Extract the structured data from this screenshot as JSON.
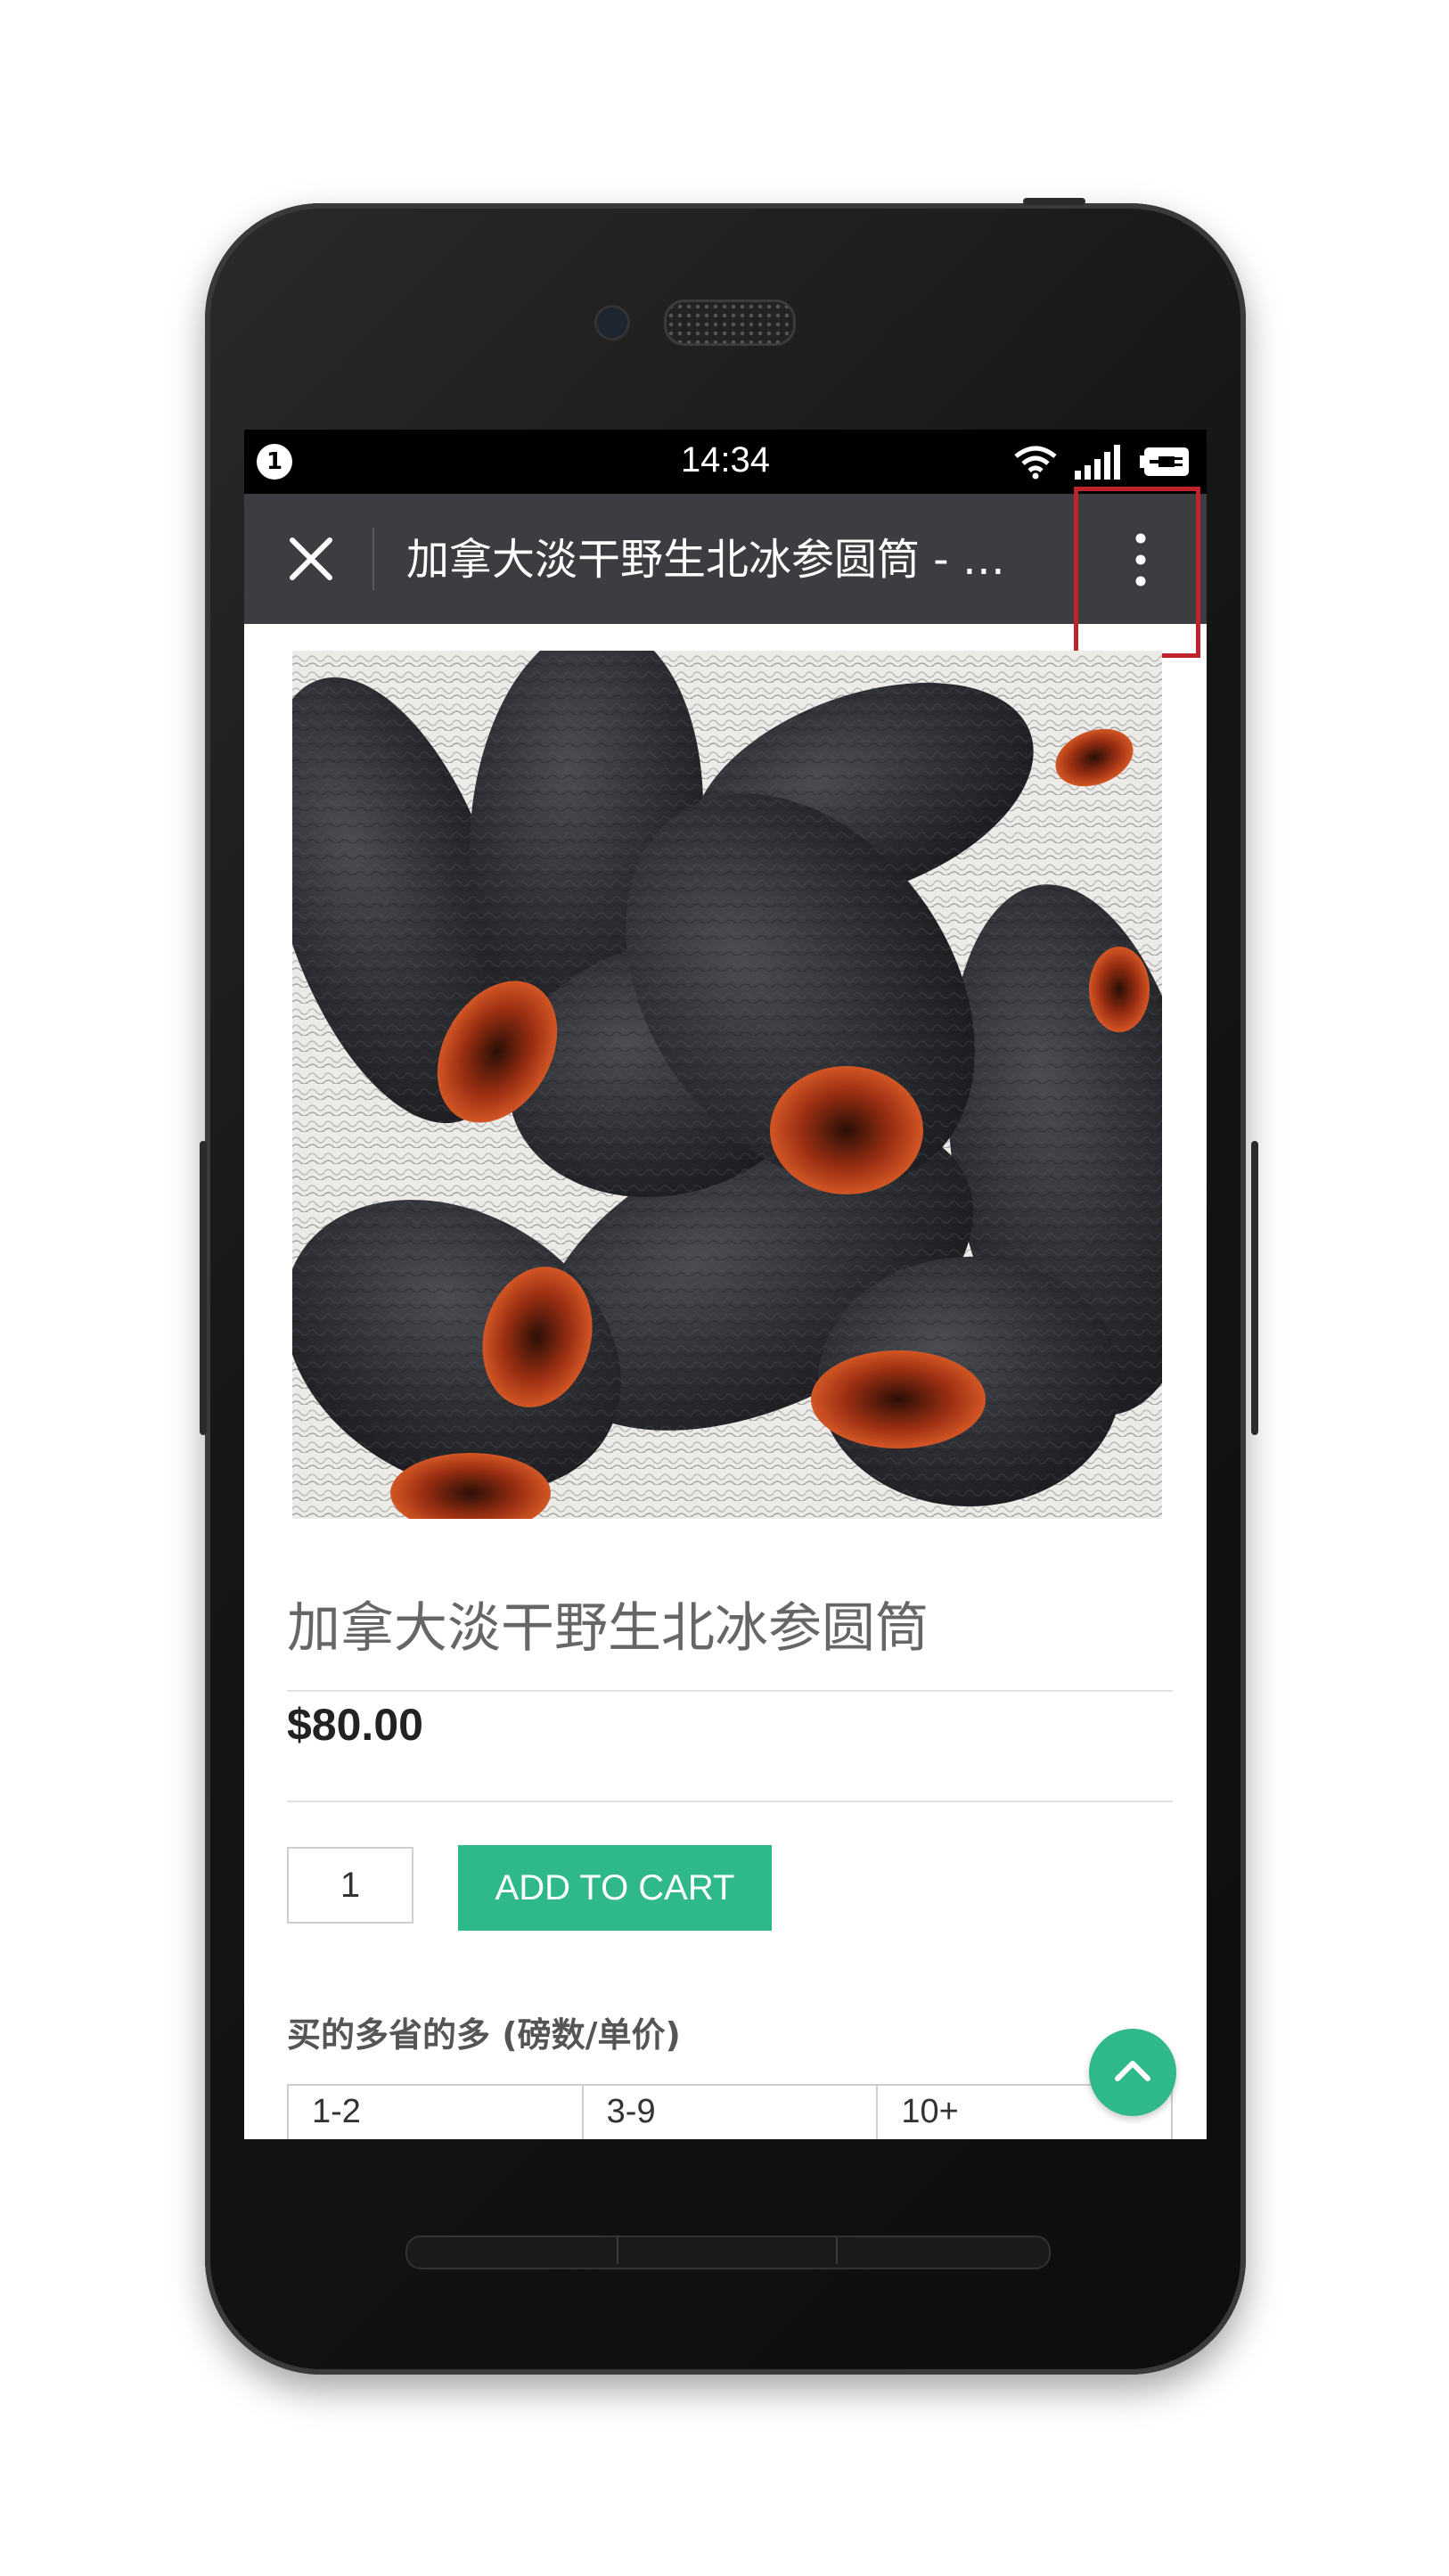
{
  "status_bar": {
    "notification_badge": "1",
    "time": "14:34",
    "icons": [
      "wifi-icon",
      "signal-icon",
      "battery-charging-icon"
    ]
  },
  "toolbar": {
    "title": "加拿大淡干野生北冰参圆筒 - …",
    "close_icon": "close-icon",
    "menu_icon": "more-vertical-icon"
  },
  "product": {
    "image_alt": "dried sea cucumber",
    "title": "加拿大淡干野生北冰参圆筒",
    "price": "$80.00",
    "quantity": "1",
    "add_to_cart_label": "ADD TO CART"
  },
  "bulk_pricing": {
    "title": "买的多省的多 (磅数/单价)",
    "columns": [
      "1-2",
      "3-9",
      "10+"
    ]
  },
  "colors": {
    "accent": "#2fb88a",
    "toolbar": "#3b3d41",
    "highlight": "#c0232c"
  }
}
